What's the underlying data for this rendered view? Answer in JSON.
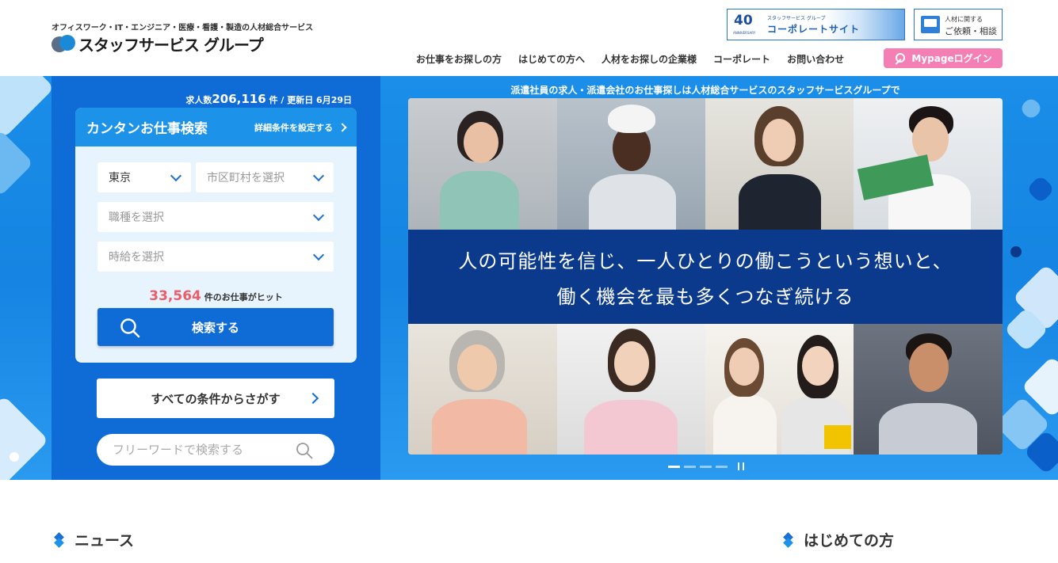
{
  "header": {
    "tagline": "オフィスワーク・IT・エンジニア・医療・看護・製造の人材総合サービス",
    "logo_text": "スタッフサービス グループ",
    "corporate_banner": {
      "badge": "40",
      "badge_sub": "ANNIVERSARY",
      "group": "スタッフサービス グループ",
      "label": "コーポレートサイト"
    },
    "request": {
      "small": "人材に関する",
      "large": "ご依頼・相談"
    },
    "nav": [
      "お仕事をお探しの方",
      "はじめての方へ",
      "人材をお探しの企業様",
      "コーポレート",
      "お問い合わせ"
    ],
    "mypage_label": "Mypageログイン"
  },
  "search": {
    "job_count_prefix": "求人数",
    "job_count": "206,116",
    "job_count_suffix": "件 / 更新日 6月29日",
    "title": "カンタンお仕事検索",
    "detail_link": "詳細条件を設定する",
    "prefecture": "東京",
    "city_placeholder": "市区町村を選択",
    "job_type_placeholder": "職種を選択",
    "wage_placeholder": "時給を選択",
    "hit_count": "33,564",
    "hit_suffix": "件のお仕事がヒット",
    "search_button": "検索する",
    "all_conditions_button": "すべての条件からさがす",
    "free_word_placeholder": "フリーワードで検索する"
  },
  "hero": {
    "caption": "派遣社員の求人・派遣会社のお仕事探しは人材総合サービスのスタッフサービスグループで",
    "slogan_line1": "人の可能性を信じ、一人ひとりの働こうという想いと、",
    "slogan_line2": "働く機会を最も多くつなぎ続ける",
    "slide_count": 4,
    "active_slide": 1
  },
  "sections": {
    "news": "ニュース",
    "first_time": "はじめての方"
  },
  "colors": {
    "primary": "#0f6cd6",
    "accent_pink": "#f47fb4",
    "hit_red": "#ec5d6a",
    "slogan_band": "#0b3a8c"
  }
}
